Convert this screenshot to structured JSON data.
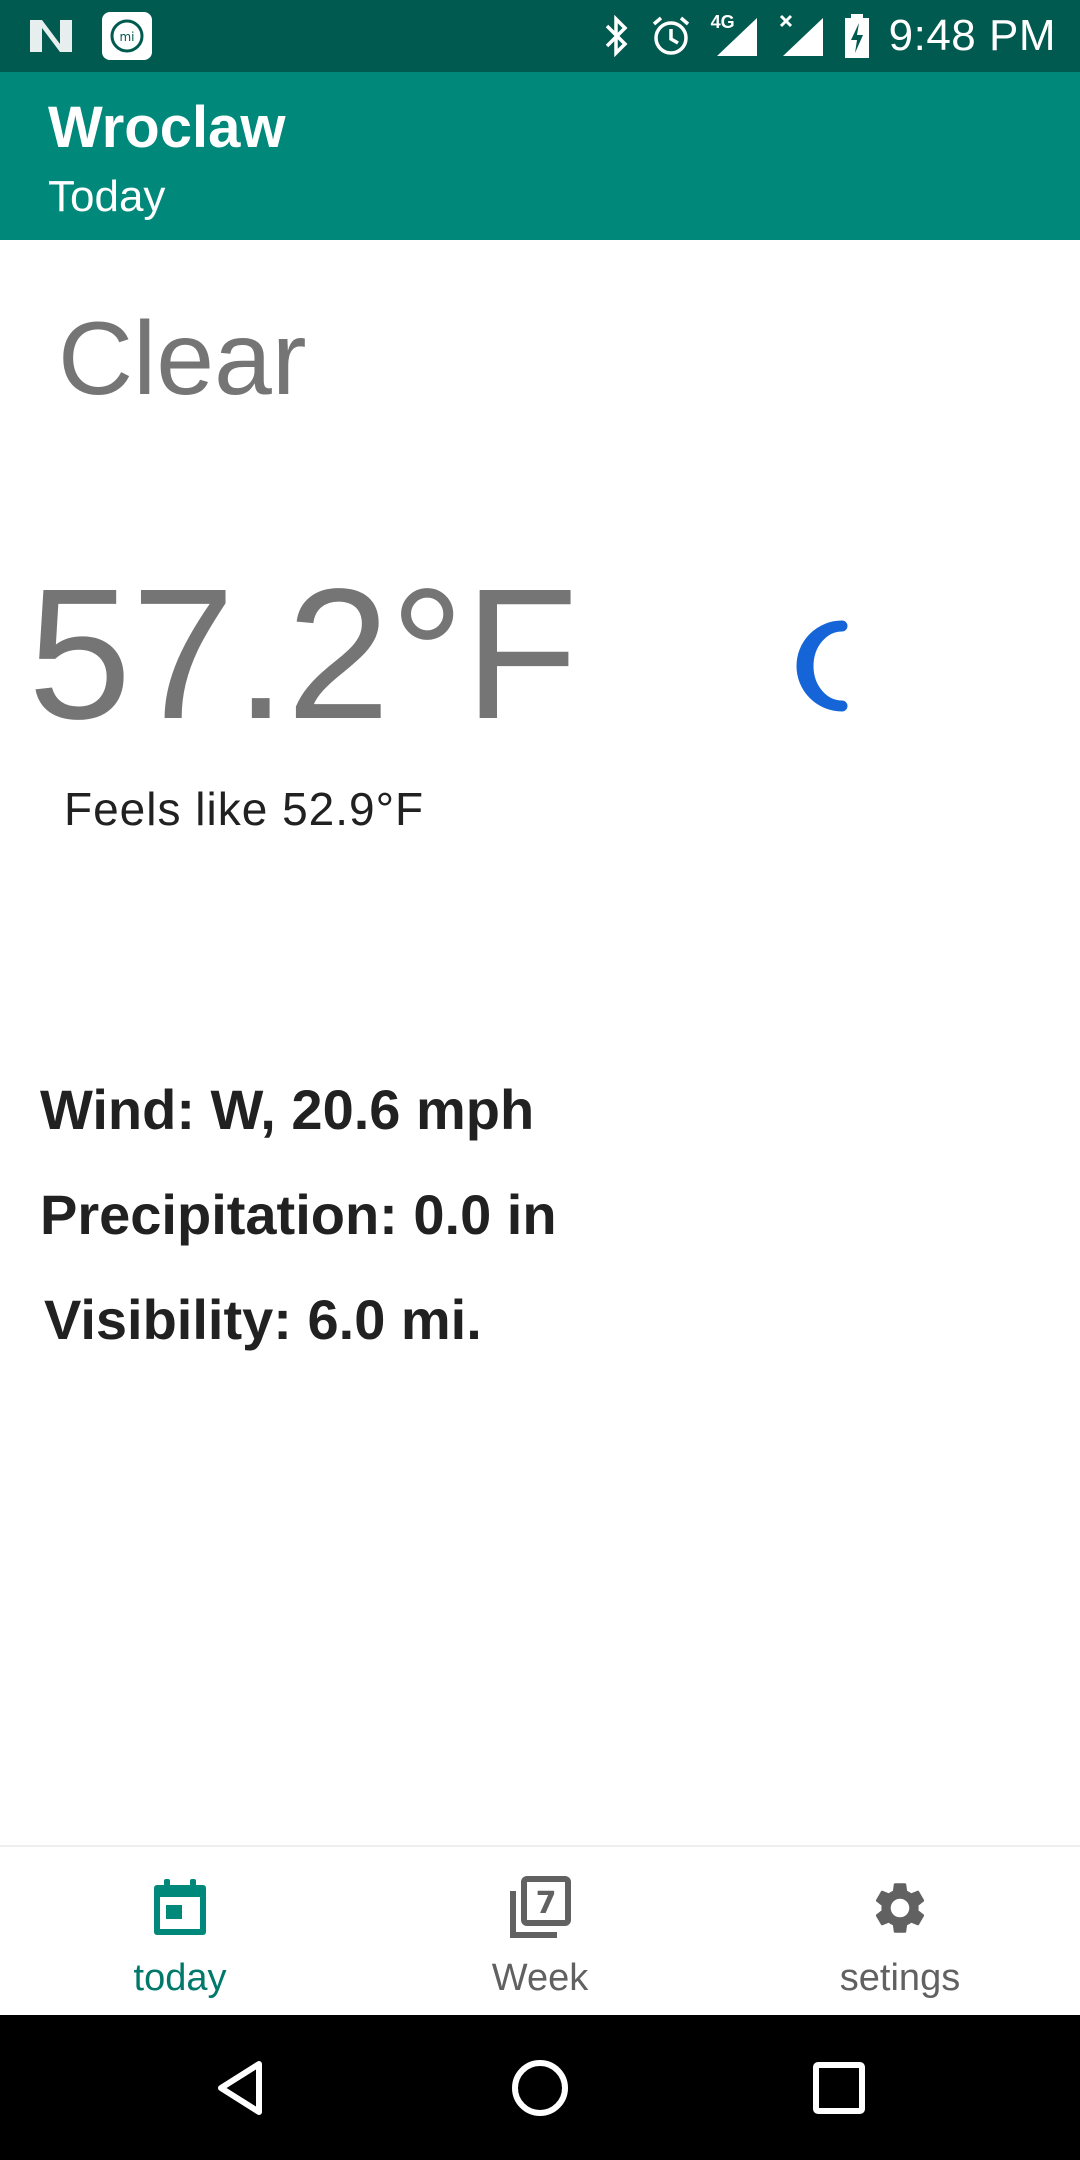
{
  "status_bar": {
    "time": "9:48 PM",
    "network": "4G",
    "icons": [
      "n-logo-icon",
      "mi-app-icon",
      "bluetooth-icon",
      "alarm-icon",
      "signal-icon",
      "signal-no-service-icon",
      "battery-charging-icon"
    ]
  },
  "app_bar": {
    "city": "Wroclaw",
    "subtitle": "Today",
    "color": "#00897b"
  },
  "weather": {
    "condition": "Clear",
    "temperature": "57.2°F",
    "feels_like": "Feels like 52.9°F",
    "icon": "moon-icon",
    "icon_color": "#1565d8"
  },
  "details": {
    "wind": "Wind: W, 20.6 mph",
    "precipitation": "Precipitation: 0.0 in",
    "visibility": "Visibility: 6.0 mi."
  },
  "bottom_nav": {
    "items": [
      {
        "label": "today",
        "icon": "calendar-icon",
        "active": true
      },
      {
        "label": "Week",
        "icon": "week-7-icon",
        "active": false
      },
      {
        "label": "setings",
        "icon": "gear-icon",
        "active": false
      }
    ],
    "active_color": "#00796b",
    "inactive_color": "#616161"
  },
  "system_nav": {
    "buttons": [
      "back-icon",
      "home-icon",
      "recents-icon"
    ]
  }
}
